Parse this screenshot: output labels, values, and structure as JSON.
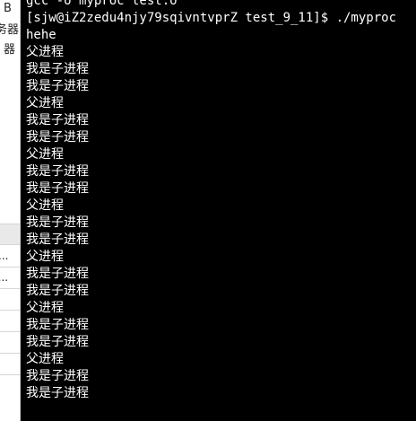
{
  "left_panel": {
    "top_texts": [
      "B",
      "服务器",
      "器"
    ],
    "rows": [
      "...",
      "3..."
    ]
  },
  "terminal": {
    "lines": [
      "gcc -o myproc test.o",
      "[sjw@iZ2zedu4njy79sqivntvprZ test_9_11]$ ./myproc",
      "hehe",
      "父进程",
      "我是子进程",
      "我是子进程",
      "父进程",
      "我是子进程",
      "我是子进程",
      "父进程",
      "我是子进程",
      "我是子进程",
      "父进程",
      "我是子进程",
      "我是子进程",
      "父进程",
      "我是子进程",
      "我是子进程",
      "父进程",
      "我是子进程",
      "我是子进程",
      "父进程",
      "我是子进程",
      "我是子进程"
    ]
  }
}
